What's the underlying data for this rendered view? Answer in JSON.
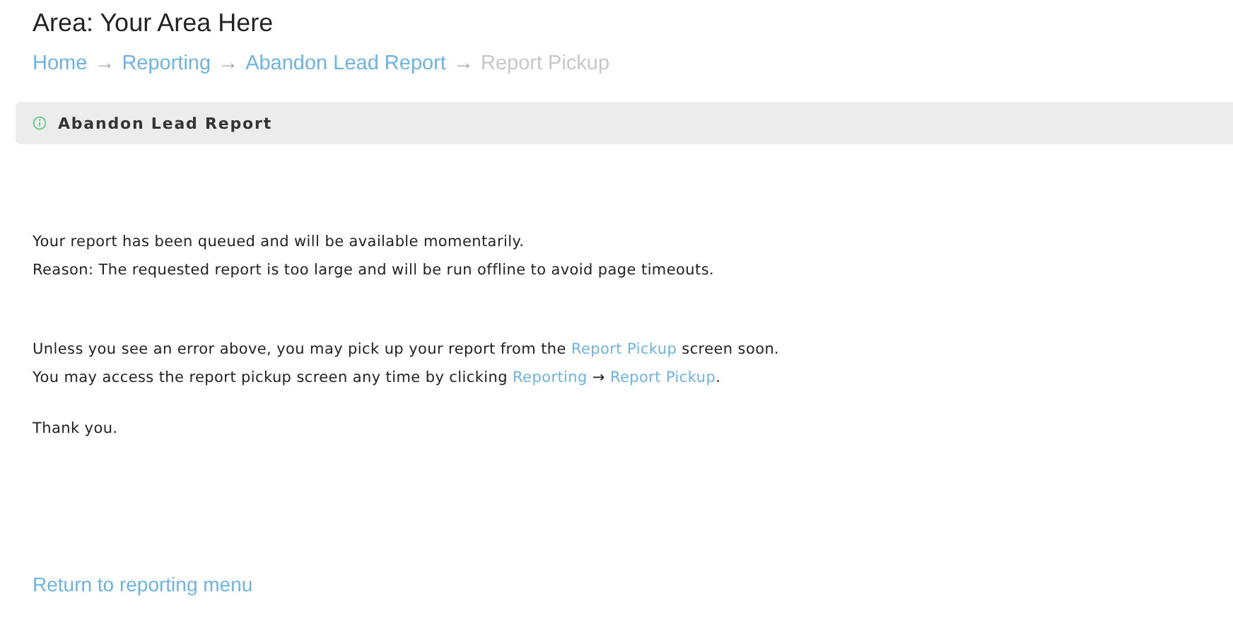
{
  "area_title": "Area: Your Area Here",
  "breadcrumb": {
    "separator": "→",
    "items": [
      {
        "label": "Home",
        "current": false
      },
      {
        "label": "Reporting",
        "current": false
      },
      {
        "label": "Abandon Lead Report",
        "current": false
      },
      {
        "label": "Report Pickup",
        "current": true
      }
    ]
  },
  "panel": {
    "title": "Abandon Lead Report"
  },
  "paragraphs": [
    [
      [
        {
          "kind": "text",
          "text": "Your report has been queued and will be available momentarily."
        }
      ],
      [
        {
          "kind": "text",
          "text": "Reason: The requested report is too large and will be run offline to avoid page timeouts."
        }
      ]
    ],
    [
      [
        {
          "kind": "text",
          "text": "Unless you see an error above, you may pick up your report from the "
        },
        {
          "kind": "link",
          "text": "Report Pickup"
        },
        {
          "kind": "text",
          "text": " screen soon."
        }
      ],
      [
        {
          "kind": "text",
          "text": "You may access the report pickup screen any time by clicking "
        },
        {
          "kind": "link",
          "text": "Reporting"
        },
        {
          "kind": "text",
          "text": " → "
        },
        {
          "kind": "link",
          "text": "Report Pickup"
        },
        {
          "kind": "text",
          "text": "."
        }
      ]
    ],
    [
      [
        {
          "kind": "text",
          "text": "Thank you."
        }
      ]
    ]
  ],
  "return_link": "Return to reporting menu"
}
